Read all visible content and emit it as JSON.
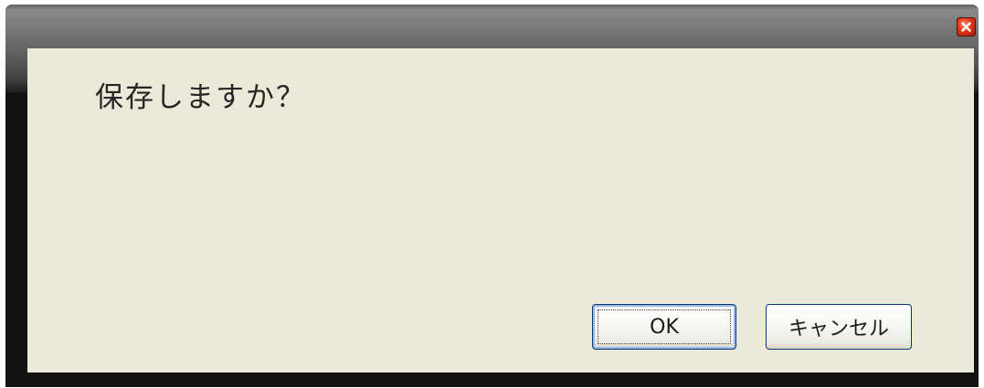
{
  "dialog": {
    "message": "保存しますか？",
    "ok_label": "OK",
    "cancel_label": "キャンセル"
  },
  "titlebar": {
    "close_icon": "close-icon"
  },
  "colors": {
    "client_background": "#ece9d8",
    "frame_background": "#121212",
    "close_button": "#e2371a"
  }
}
